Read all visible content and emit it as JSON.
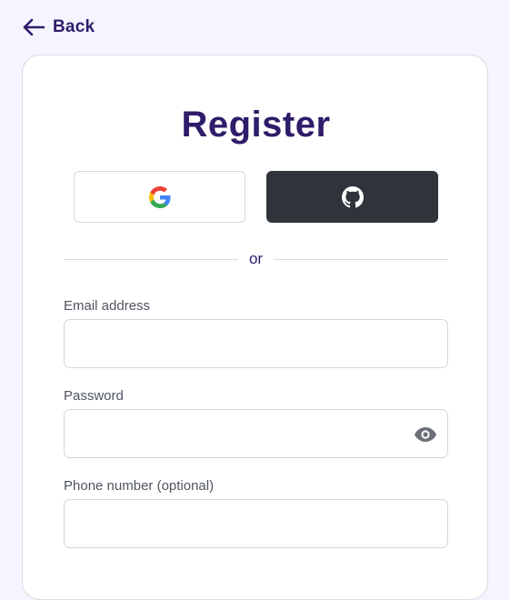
{
  "back": {
    "label": "Back",
    "icon": "arrow-left-icon"
  },
  "title": "Register",
  "social": {
    "google_icon": "google-icon",
    "github_icon": "github-icon"
  },
  "divider_text": "or",
  "fields": {
    "email": {
      "label": "Email address",
      "value": "",
      "placeholder": ""
    },
    "password": {
      "label": "Password",
      "value": "",
      "placeholder": "",
      "toggle_icon": "eye-icon"
    },
    "phone": {
      "label": "Phone number (optional)",
      "value": "",
      "placeholder": ""
    }
  },
  "colors": {
    "page_background": "#f4f5ff",
    "brand_text": "#2f1c6a",
    "github_button": "#2f343b",
    "input_border": "#d4d6db"
  }
}
